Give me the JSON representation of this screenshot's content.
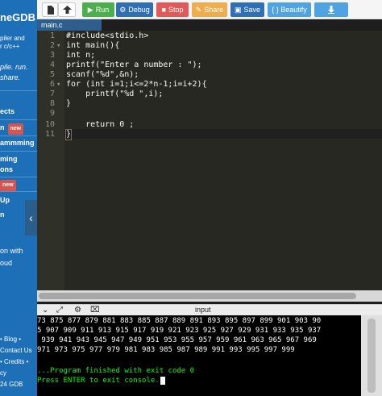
{
  "sidebar": {
    "brand": "neGDB",
    "subtitle_lines": [
      "piler and",
      "r c/c++"
    ],
    "tagline_lines": [
      "pile. run.",
      "share."
    ],
    "items": [
      {
        "label": "ects"
      },
      {
        "label": "n",
        "badge": "new"
      },
      {
        "label": "ammming"
      },
      {
        "label": "ming"
      },
      {
        "label": "ons"
      },
      {
        "label": "",
        "badge": "new"
      },
      {
        "label": "Up"
      },
      {
        "label": "n"
      }
    ],
    "promo_lines": [
      "on with",
      "oud"
    ],
    "footer_lines": [
      "• Blog •",
      "Contact Us",
      "• Credits •",
      "cy",
      "24 GDB"
    ]
  },
  "toolbar": {
    "buttons": [
      {
        "name": "new-file-button",
        "label": ""
      },
      {
        "name": "upload-button",
        "label": ""
      },
      {
        "name": "run-button",
        "label": "Run"
      },
      {
        "name": "debug-button",
        "label": "Debug"
      },
      {
        "name": "stop-button",
        "label": "Stop"
      },
      {
        "name": "share-button",
        "label": "Share"
      },
      {
        "name": "save-button",
        "label": "Save"
      },
      {
        "name": "beautify-button",
        "label": "{ } Beautify"
      },
      {
        "name": "download-button",
        "label": ""
      }
    ]
  },
  "tab": {
    "filename": "main.c"
  },
  "editor": {
    "lines": [
      {
        "n": "1",
        "fold": "",
        "code": "#include<stdio.h>"
      },
      {
        "n": "2",
        "fold": "▾",
        "code": "int main(){"
      },
      {
        "n": "3",
        "fold": "",
        "code": "int n;"
      },
      {
        "n": "4",
        "fold": "",
        "code": "printf(\"Enter a number : \");"
      },
      {
        "n": "5",
        "fold": "",
        "code": "scanf(\"%d\",&n);"
      },
      {
        "n": "6",
        "fold": "▾",
        "code": "for (int i=1;i<=2*n-1;i=i+2){"
      },
      {
        "n": "7",
        "fold": "",
        "code": "    printf(\"%d \",i);"
      },
      {
        "n": "8",
        "fold": "",
        "code": "}"
      },
      {
        "n": "9",
        "fold": "",
        "code": ""
      },
      {
        "n": "10",
        "fold": "",
        "code": "    return 0 ;"
      },
      {
        "n": "11",
        "fold": "",
        "code": "}"
      }
    ]
  },
  "console": {
    "label": "input",
    "output_lines": [
      "73 875 877 879 881 883 885 887 889 891 893 895 897 899 901 903 90",
      "5 907 909 911 913 915 917 919 921 923 925 927 929 931 933 935 937",
      " 939 941 943 945 947 949 951 953 955 957 959 961 963 965 967 969",
      "971 973 975 977 979 981 983 985 987 989 991 993 995 997 999",
      ""
    ],
    "exit_line": "...Program finished with exit code 0",
    "prompt_line": "Press ENTER to exit console."
  },
  "colors": {
    "sidebar": "#1d6fb8",
    "run": "#4cae4c",
    "debug": "#2f6fb3",
    "stop": "#e05a5a",
    "share": "#f0ad4e",
    "save": "#2f6fb3",
    "beautify": "#4fa3e0",
    "download": "#4fa3e0"
  }
}
